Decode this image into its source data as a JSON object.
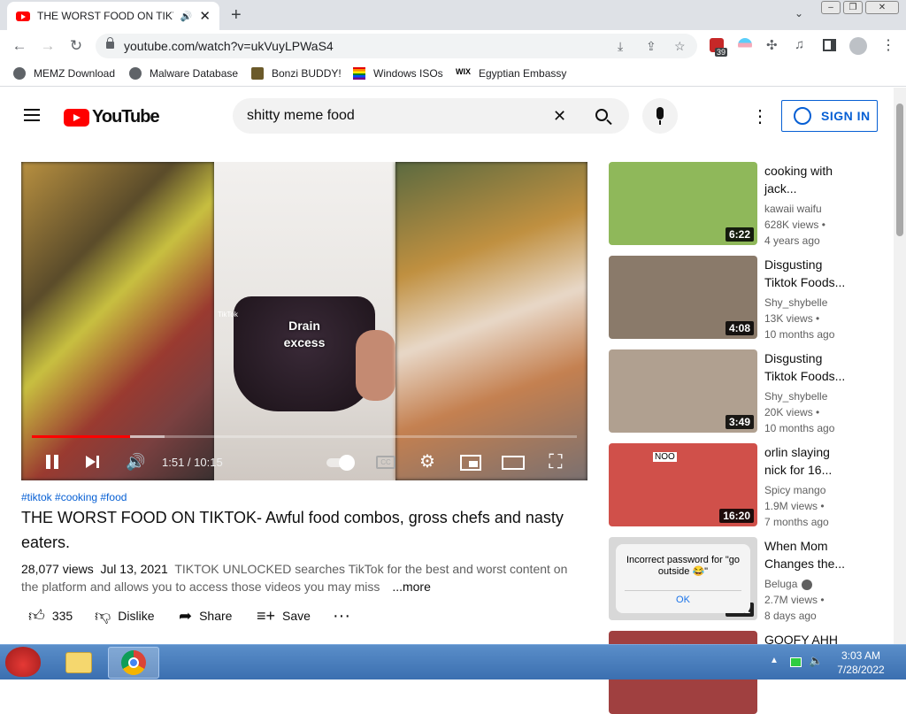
{
  "browser": {
    "tab_title": "THE WORST FOOD ON TIKTOK",
    "new_tab": "+",
    "url": "youtube.com/watch?v=ukVuyLPWaS4",
    "extension_badge": "39",
    "bookmarks": [
      "MEMZ Download",
      "Malware Database",
      "Bonzi BUDDY!",
      "Windows ISOs",
      "Egyptian Embassy"
    ]
  },
  "header": {
    "logo_text": "YouTube",
    "search_value": "shitty meme food",
    "signin_label": "SIGN IN"
  },
  "player": {
    "caption": "Drain excess",
    "watermark": "TikTok",
    "time": "1:51 / 10:15",
    "progress_fraction": 0.181
  },
  "video": {
    "tags": "#tiktok #cooking #food",
    "title": "THE WORST FOOD ON TIKTOK- Awful food combos, gross chefs and nasty eaters.",
    "views": "28,077 views",
    "date": "Jul 13, 2021",
    "description": "TIKTOK UNLOCKED searches TikTok for the best and worst content on the platform and allows you to access those videos you may miss",
    "more": "...more",
    "likes": "335",
    "dislike_label": "Dislike",
    "share_label": "Share",
    "save_label": "Save"
  },
  "recommendations": [
    {
      "title1": "cooking with",
      "title2": "jack...",
      "channel": "kawaii waifu",
      "views": "628K views",
      "age": "4 years ago",
      "duration": "6:22",
      "color": "#8fb85a"
    },
    {
      "title1": "Disgusting",
      "title2": "Tiktok Foods...",
      "channel": "Shy_shybelle",
      "views": "13K views",
      "age": "10 months ago",
      "duration": "4:08",
      "color": "#8a7a6a"
    },
    {
      "title1": "Disgusting",
      "title2": "Tiktok Foods...",
      "channel": "Shy_shybelle",
      "views": "20K views",
      "age": "10 months ago",
      "duration": "3:49",
      "color": "#b0a090"
    },
    {
      "title1": "orlin slaying",
      "title2": "nick for 16...",
      "channel": "Spicy mango",
      "views": "1.9M views",
      "age": "7 months ago",
      "duration": "16:20",
      "color": "#d0504a"
    },
    {
      "title1": "When Mom",
      "title2": "Changes the...",
      "channel": "Beluga",
      "views": "2.7M views",
      "age": "8 days ago",
      "duration": "2:31",
      "color": "#d8d8d8"
    },
    {
      "title1": "GOOFY AHH",
      "title2": "",
      "channel": "",
      "views": "",
      "age": "",
      "duration": "",
      "color": "#a04040"
    }
  ],
  "rec5_dialog": {
    "text": "Incorrect password for \"go outside 😂\"",
    "ok": "OK"
  },
  "rec4_overlay": "NOO",
  "taskbar": {
    "time": "3:03 AM",
    "date": "7/28/2022"
  }
}
